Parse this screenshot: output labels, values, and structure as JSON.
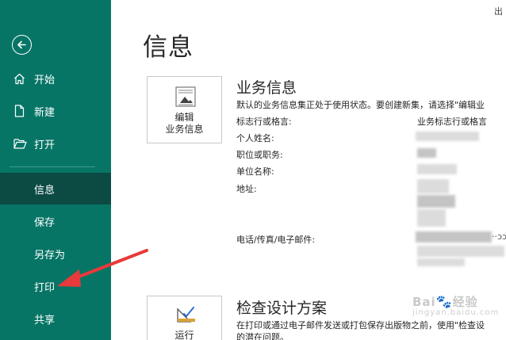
{
  "header": {
    "signin_text": "出"
  },
  "nav": {
    "items": [
      {
        "label": "开始",
        "icon": "home-icon"
      },
      {
        "label": "新建",
        "icon": "new-document-icon"
      },
      {
        "label": "打开",
        "icon": "open-folder-icon"
      },
      {
        "label": "信息",
        "active": true
      },
      {
        "label": "保存"
      },
      {
        "label": "另存为"
      },
      {
        "label": "打印"
      },
      {
        "label": "共享"
      }
    ],
    "back_icon": "back-arrow-icon"
  },
  "main": {
    "page_title": "信息",
    "business_info": {
      "card_line1": "编辑",
      "card_line2": "业务信息",
      "card_icon": "business-card-icon",
      "title": "业务信息",
      "description": "默认的业务信息集正处于使用状态。要创建新集，请选择\"编辑业",
      "fields": [
        {
          "label": "标志行或格言:",
          "value": "业务标志行或格言"
        },
        {
          "label": "个人姓名:"
        },
        {
          "label": "职位或职务:"
        },
        {
          "label": "单位名称:"
        },
        {
          "label": "地址:"
        },
        {
          "label": "电话/传真/电子邮件:",
          "value_tail": "··ɔɔ"
        }
      ]
    },
    "design_checker": {
      "card_line1": "运行",
      "card_icon": "design-checker-icon",
      "title": "检查设计方案",
      "description_line1": "在打印或通过电子邮件发送或打包保存出版物之前，使用\"检查设",
      "description_line2": "的潜在问题。"
    }
  },
  "watermark": {
    "text": "Bai",
    "paw": "🐾",
    "text2": "经验",
    "sub": "jingyan.baidu.com"
  },
  "colors": {
    "rail": "#077566",
    "rail_active": "#0c4a44",
    "arrow": "#e83a3a"
  }
}
